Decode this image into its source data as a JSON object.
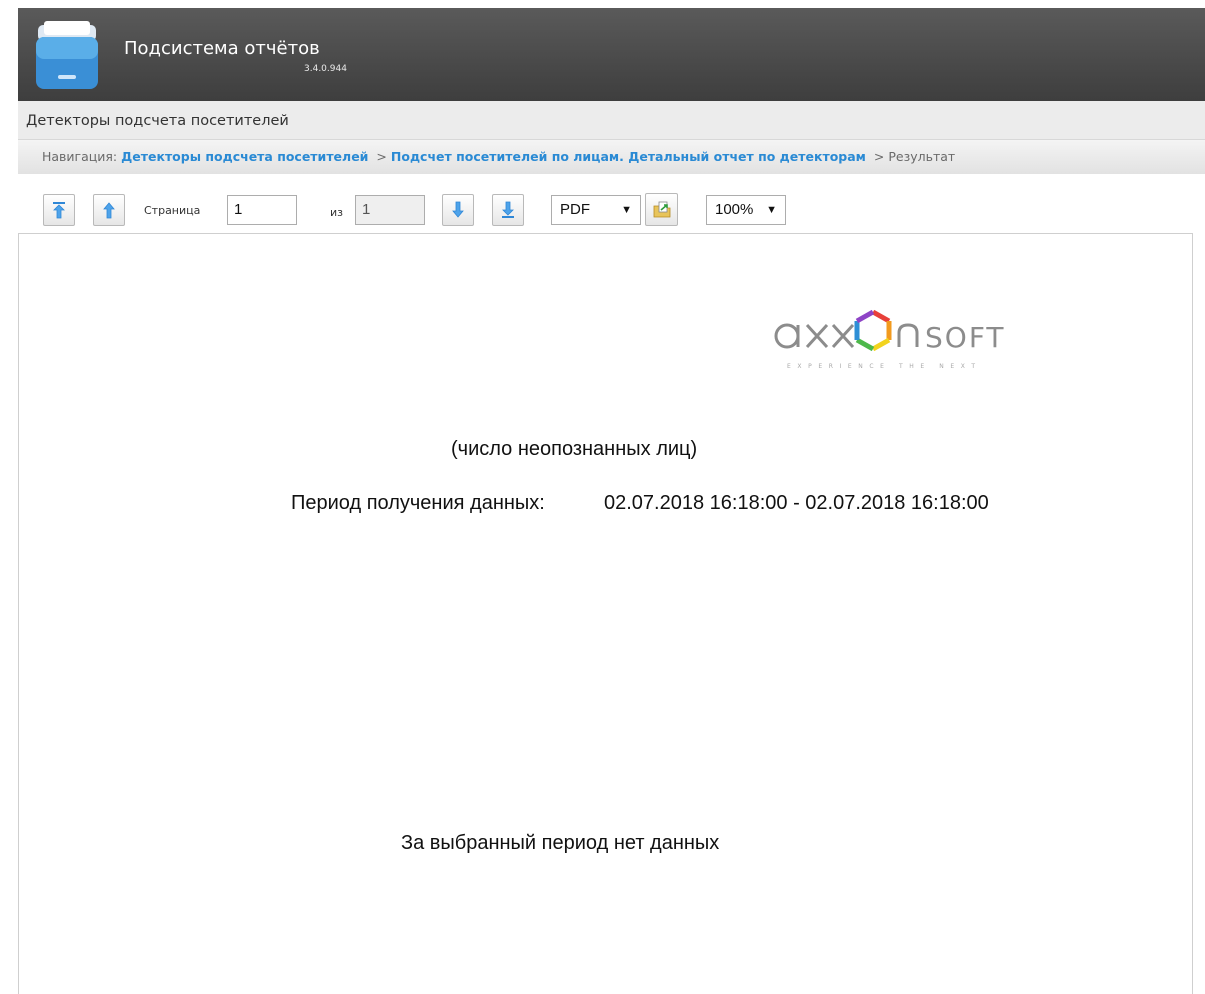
{
  "app": {
    "title": "Подсистема отчётов",
    "version": "3.4.0.944",
    "logo_icon": "folder-icon"
  },
  "section": {
    "title": "Детекторы подсчета посетителей"
  },
  "breadcrumb": {
    "prefix": "Навигация:",
    "items": [
      {
        "label": "Детекторы подсчета посетителей",
        "link": true
      },
      {
        "label": "Подсчет посетителей по лицам. Детальный отчет по детекторам",
        "link": true
      },
      {
        "label": "Результат",
        "link": false
      }
    ],
    "separator": ">"
  },
  "toolbar": {
    "first_page_icon": "first-page-icon",
    "prev_page_icon": "prev-page-icon",
    "page_label": "Страница",
    "page_value": "1",
    "of_label": "из",
    "total_pages": "1",
    "next_page_icon": "next-page-icon",
    "last_page_icon": "last-page-icon",
    "export_format": "PDF",
    "export_icon": "export-icon",
    "zoom": "100%"
  },
  "report": {
    "brand_name": "axxonsoft",
    "brand_tagline": "EXPERIENCE THE NEXT",
    "subtitle": "(число неопознанных лиц)",
    "period_label": "Период получения данных:",
    "period_value": "02.07.2018 16:18:00 - 02.07.2018 16:18:00",
    "no_data": "За выбранный период нет данных"
  },
  "colors": {
    "header_bg": "#4a4a4a",
    "link": "#2a8ad4",
    "brand_grey": "#8c8c8c"
  }
}
